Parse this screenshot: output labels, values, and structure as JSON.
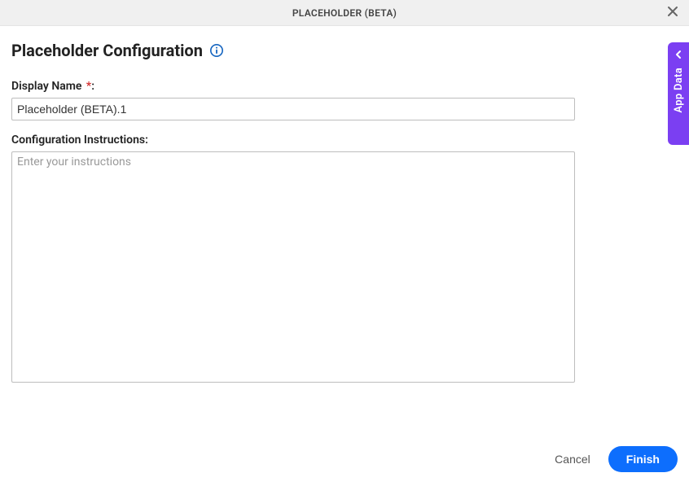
{
  "header": {
    "title": "PLACEHOLDER (BETA)"
  },
  "page": {
    "title": "Placeholder Configuration"
  },
  "form": {
    "display_name": {
      "label": "Display Name",
      "required_suffix": ":",
      "value": "Placeholder (BETA).1"
    },
    "instructions": {
      "label": "Configuration Instructions:",
      "placeholder": "Enter your instructions",
      "value": ""
    }
  },
  "footer": {
    "cancel": "Cancel",
    "finish": "Finish"
  },
  "side_tab": {
    "label": "App Data"
  }
}
